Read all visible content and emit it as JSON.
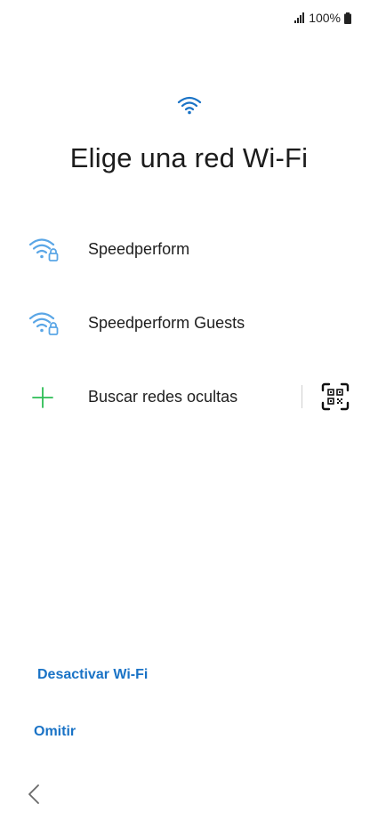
{
  "status_bar": {
    "battery_text": "100%"
  },
  "header": {
    "title": "Elige una red Wi-Fi"
  },
  "networks": [
    {
      "name": "Speedperform",
      "secured": true
    },
    {
      "name": "Speedperform Guests",
      "secured": true
    }
  ],
  "hidden_networks": {
    "label": "Buscar redes ocultas"
  },
  "links": {
    "disable_wifi": "Desactivar Wi-Fi",
    "skip": "Omitir"
  },
  "icons": {
    "wifi_header": "wifi-icon",
    "network": "wifi-lock-icon",
    "add": "plus-icon",
    "qr": "qr-scan-icon",
    "back": "chevron-left-icon"
  },
  "colors": {
    "accent_blue": "#1a73c6",
    "wifi_icon_blue": "#5aa6e6",
    "plus_green": "#2dbd55"
  }
}
